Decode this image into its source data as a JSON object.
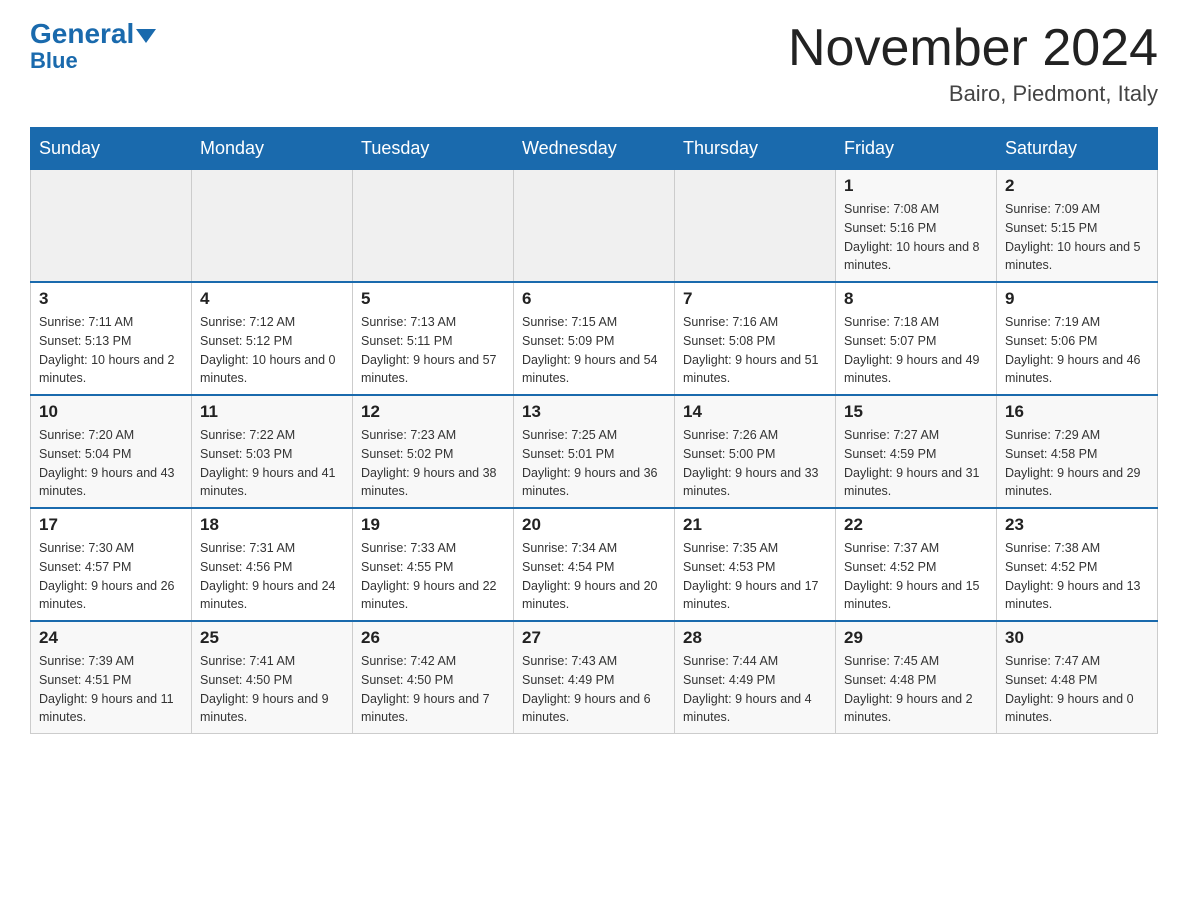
{
  "header": {
    "logo_general": "General",
    "logo_blue": "Blue",
    "month_title": "November 2024",
    "location": "Bairo, Piedmont, Italy"
  },
  "days_of_week": [
    "Sunday",
    "Monday",
    "Tuesday",
    "Wednesday",
    "Thursday",
    "Friday",
    "Saturday"
  ],
  "weeks": [
    [
      {
        "day": "",
        "info": ""
      },
      {
        "day": "",
        "info": ""
      },
      {
        "day": "",
        "info": ""
      },
      {
        "day": "",
        "info": ""
      },
      {
        "day": "",
        "info": ""
      },
      {
        "day": "1",
        "info": "Sunrise: 7:08 AM\nSunset: 5:16 PM\nDaylight: 10 hours and 8 minutes."
      },
      {
        "day": "2",
        "info": "Sunrise: 7:09 AM\nSunset: 5:15 PM\nDaylight: 10 hours and 5 minutes."
      }
    ],
    [
      {
        "day": "3",
        "info": "Sunrise: 7:11 AM\nSunset: 5:13 PM\nDaylight: 10 hours and 2 minutes."
      },
      {
        "day": "4",
        "info": "Sunrise: 7:12 AM\nSunset: 5:12 PM\nDaylight: 10 hours and 0 minutes."
      },
      {
        "day": "5",
        "info": "Sunrise: 7:13 AM\nSunset: 5:11 PM\nDaylight: 9 hours and 57 minutes."
      },
      {
        "day": "6",
        "info": "Sunrise: 7:15 AM\nSunset: 5:09 PM\nDaylight: 9 hours and 54 minutes."
      },
      {
        "day": "7",
        "info": "Sunrise: 7:16 AM\nSunset: 5:08 PM\nDaylight: 9 hours and 51 minutes."
      },
      {
        "day": "8",
        "info": "Sunrise: 7:18 AM\nSunset: 5:07 PM\nDaylight: 9 hours and 49 minutes."
      },
      {
        "day": "9",
        "info": "Sunrise: 7:19 AM\nSunset: 5:06 PM\nDaylight: 9 hours and 46 minutes."
      }
    ],
    [
      {
        "day": "10",
        "info": "Sunrise: 7:20 AM\nSunset: 5:04 PM\nDaylight: 9 hours and 43 minutes."
      },
      {
        "day": "11",
        "info": "Sunrise: 7:22 AM\nSunset: 5:03 PM\nDaylight: 9 hours and 41 minutes."
      },
      {
        "day": "12",
        "info": "Sunrise: 7:23 AM\nSunset: 5:02 PM\nDaylight: 9 hours and 38 minutes."
      },
      {
        "day": "13",
        "info": "Sunrise: 7:25 AM\nSunset: 5:01 PM\nDaylight: 9 hours and 36 minutes."
      },
      {
        "day": "14",
        "info": "Sunrise: 7:26 AM\nSunset: 5:00 PM\nDaylight: 9 hours and 33 minutes."
      },
      {
        "day": "15",
        "info": "Sunrise: 7:27 AM\nSunset: 4:59 PM\nDaylight: 9 hours and 31 minutes."
      },
      {
        "day": "16",
        "info": "Sunrise: 7:29 AM\nSunset: 4:58 PM\nDaylight: 9 hours and 29 minutes."
      }
    ],
    [
      {
        "day": "17",
        "info": "Sunrise: 7:30 AM\nSunset: 4:57 PM\nDaylight: 9 hours and 26 minutes."
      },
      {
        "day": "18",
        "info": "Sunrise: 7:31 AM\nSunset: 4:56 PM\nDaylight: 9 hours and 24 minutes."
      },
      {
        "day": "19",
        "info": "Sunrise: 7:33 AM\nSunset: 4:55 PM\nDaylight: 9 hours and 22 minutes."
      },
      {
        "day": "20",
        "info": "Sunrise: 7:34 AM\nSunset: 4:54 PM\nDaylight: 9 hours and 20 minutes."
      },
      {
        "day": "21",
        "info": "Sunrise: 7:35 AM\nSunset: 4:53 PM\nDaylight: 9 hours and 17 minutes."
      },
      {
        "day": "22",
        "info": "Sunrise: 7:37 AM\nSunset: 4:52 PM\nDaylight: 9 hours and 15 minutes."
      },
      {
        "day": "23",
        "info": "Sunrise: 7:38 AM\nSunset: 4:52 PM\nDaylight: 9 hours and 13 minutes."
      }
    ],
    [
      {
        "day": "24",
        "info": "Sunrise: 7:39 AM\nSunset: 4:51 PM\nDaylight: 9 hours and 11 minutes."
      },
      {
        "day": "25",
        "info": "Sunrise: 7:41 AM\nSunset: 4:50 PM\nDaylight: 9 hours and 9 minutes."
      },
      {
        "day": "26",
        "info": "Sunrise: 7:42 AM\nSunset: 4:50 PM\nDaylight: 9 hours and 7 minutes."
      },
      {
        "day": "27",
        "info": "Sunrise: 7:43 AM\nSunset: 4:49 PM\nDaylight: 9 hours and 6 minutes."
      },
      {
        "day": "28",
        "info": "Sunrise: 7:44 AM\nSunset: 4:49 PM\nDaylight: 9 hours and 4 minutes."
      },
      {
        "day": "29",
        "info": "Sunrise: 7:45 AM\nSunset: 4:48 PM\nDaylight: 9 hours and 2 minutes."
      },
      {
        "day": "30",
        "info": "Sunrise: 7:47 AM\nSunset: 4:48 PM\nDaylight: 9 hours and 0 minutes."
      }
    ]
  ]
}
